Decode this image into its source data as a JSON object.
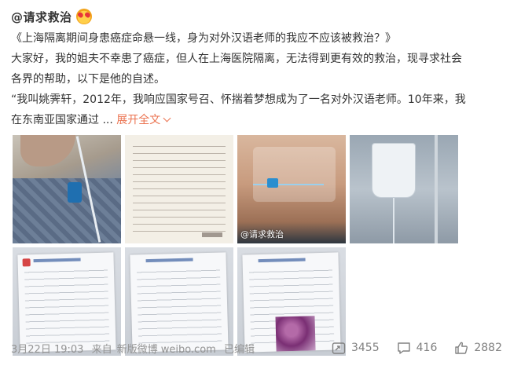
{
  "post": {
    "author": "@请求救治",
    "emoji_icon": "heart-eyes-emoji",
    "text_lines": [
      "《上海隔离期间身患癌症命悬一线，身为对外汉语老师的我应不应该被救治？》",
      "大家好，我的姐夫不幸患了癌症，但人在上海医院隔离，无法得到更有效的救治，现寻求社会",
      "各界的帮助，以下是他的自述。",
      "“我叫姚霁轩，2012年，我响应国家号召、怀揣着梦想成为了一名对外汉语老师。10年来，我"
    ],
    "last_line_prefix": "在东南亚国家通过 ... ",
    "expand_label": "展开全文",
    "watermark": "@请求救治",
    "date": "3月22日 19:03",
    "source_prefix": "来自",
    "source": "新版微博 weibo.com",
    "edited": "已编辑",
    "reposts": "3455",
    "comments": "416",
    "likes": "2882",
    "colors": {
      "link": "#eb7350",
      "meta": "#939393",
      "text": "#333333"
    }
  }
}
